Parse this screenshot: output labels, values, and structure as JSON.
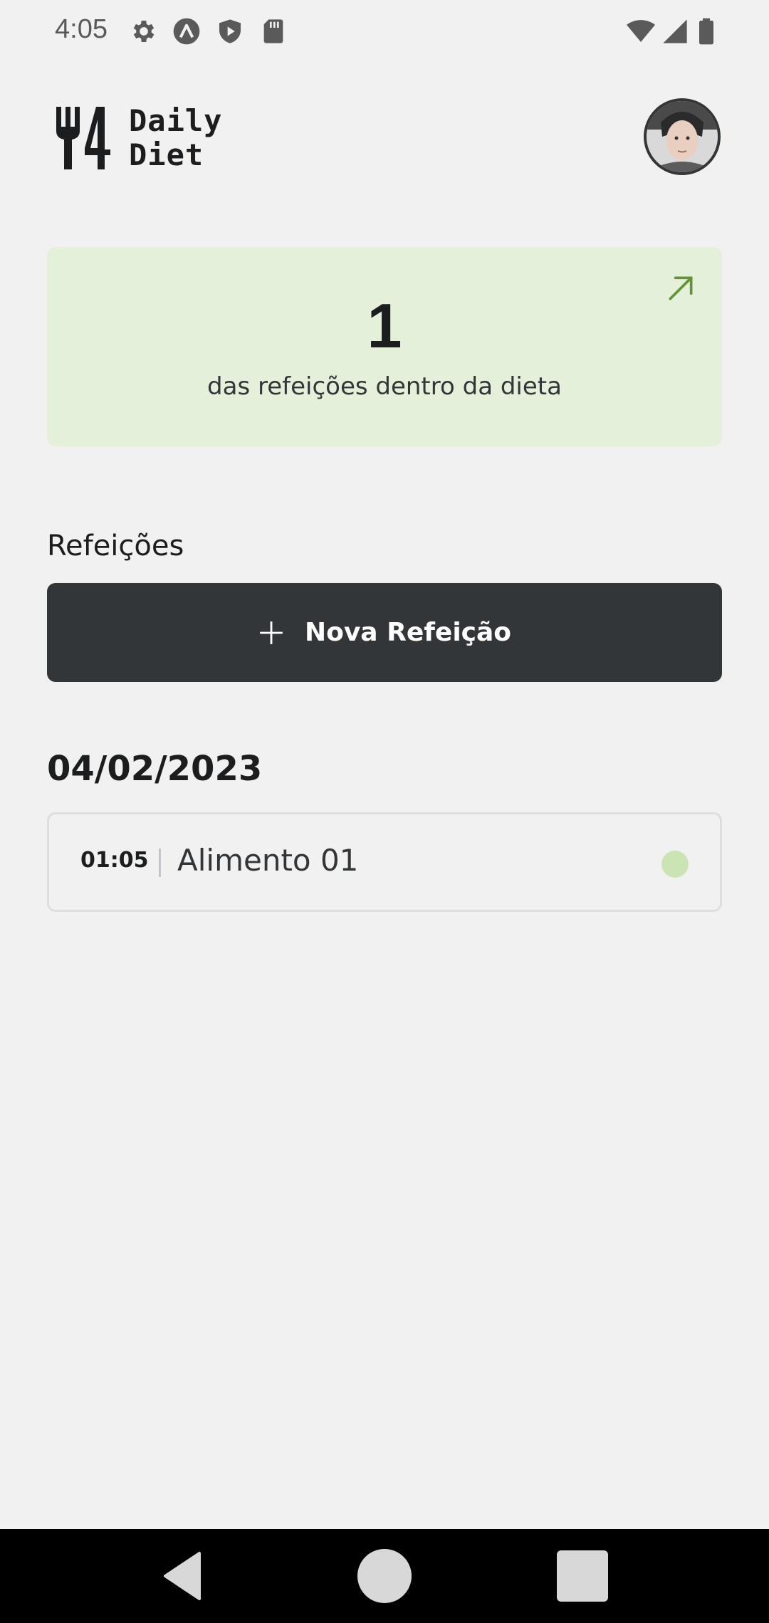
{
  "status_bar": {
    "time": "4:05",
    "icons_left": [
      "settings-icon",
      "expo-icon",
      "shield-play-icon",
      "sd-card-icon"
    ],
    "icons_right": [
      "wifi-icon",
      "signal-icon",
      "battery-icon"
    ]
  },
  "header": {
    "logo_line1": "Daily",
    "logo_line2": "Diet",
    "avatar": "user-avatar"
  },
  "stats": {
    "value": "1",
    "caption": "das refeições dentro da dieta",
    "background": "#e5f0db",
    "accent": "#639339"
  },
  "meals": {
    "section_title": "Refeições",
    "new_button_label": "Nova Refeição",
    "groups": [
      {
        "date": "04/02/2023",
        "items": [
          {
            "time": "01:05",
            "name": "Alimento 01",
            "status_color": "#cbe4b4"
          }
        ]
      }
    ]
  },
  "colors": {
    "background": "#f1f1f1",
    "dark": "#333638",
    "text": "#1b1d1e"
  },
  "nav_bar": {
    "buttons": [
      "back-icon",
      "home-icon",
      "recents-icon"
    ]
  }
}
